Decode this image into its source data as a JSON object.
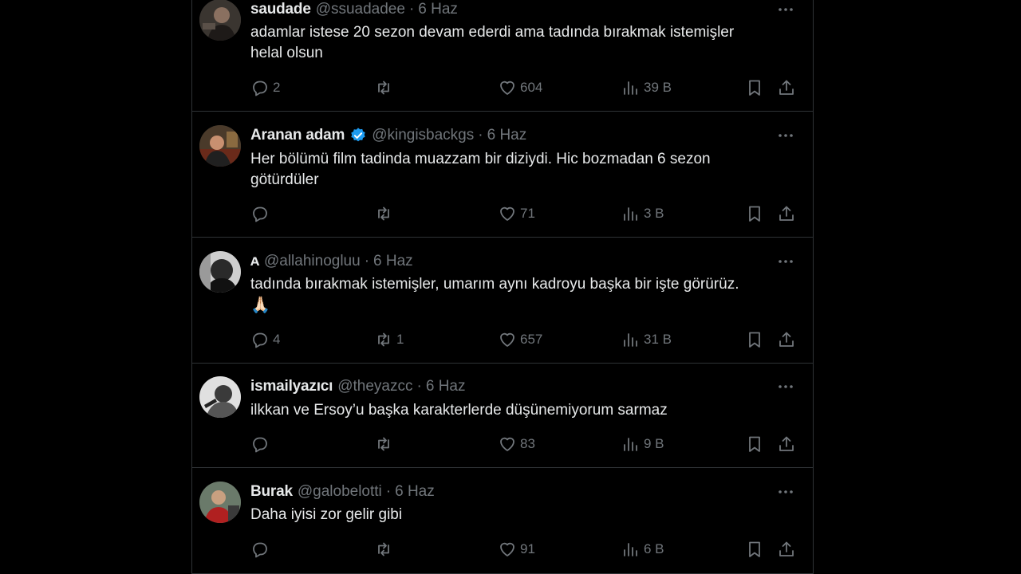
{
  "tweets": [
    {
      "name": "saudade",
      "handle": "@ssuadadee",
      "time": "6 Haz",
      "verified": false,
      "text_lines": [
        "adamlar istese 20 sezon devam ederdi ama tadında bırakmak istemişler",
        "helal olsun"
      ],
      "replies": "2",
      "retweets": "",
      "likes": "604",
      "views": "39 B"
    },
    {
      "name": "Aranan adam",
      "handle": "@kingisbackgs",
      "time": "6 Haz",
      "verified": true,
      "text_lines": [
        "Her bölümü film tadinda muazzam bir diziydi. Hic bozmadan 6 sezon",
        "götürdüler"
      ],
      "replies": "",
      "retweets": "",
      "likes": "71",
      "views": "3 B"
    },
    {
      "name": "ᴀ",
      "handle": "@allahinogluu",
      "time": "6 Haz",
      "verified": false,
      "text_lines": [
        "tadında bırakmak istemişler, umarım aynı kadroyu başka bir işte görürüz.",
        "🙏🏻"
      ],
      "replies": "4",
      "retweets": "1",
      "likes": "657",
      "views": "31 B"
    },
    {
      "name": "ismailyazıcı",
      "handle": "@theyazcc",
      "time": "6 Haz",
      "verified": false,
      "text_lines": [
        "ilkkan ve Ersoy’u başka karakterlerde düşünemiyorum sarmaz"
      ],
      "replies": "",
      "retweets": "",
      "likes": "83",
      "views": "9 B"
    },
    {
      "name": "Burak",
      "handle": "@galobelotti",
      "time": "6 Haz",
      "verified": false,
      "text_lines": [
        "Daha iyisi zor gelir gibi"
      ],
      "replies": "",
      "retweets": "",
      "likes": "91",
      "views": "6 B"
    }
  ],
  "colors": {
    "background": "#000000",
    "text": "#e7e9ea",
    "muted": "#71767b",
    "border": "#2f3336",
    "verified": "#1d9bf0"
  }
}
